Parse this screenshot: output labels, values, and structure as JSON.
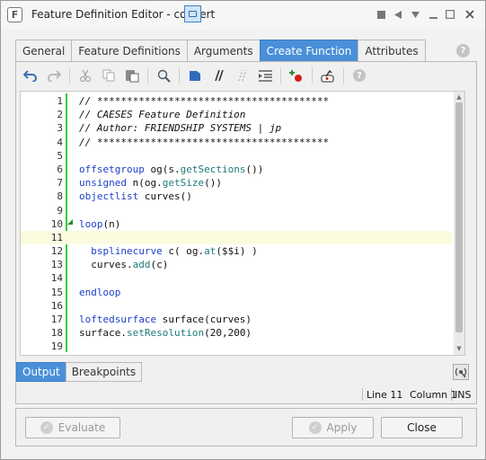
{
  "window": {
    "app_icon_letter": "F",
    "title": "Feature Definition Editor - convert"
  },
  "tabs": [
    {
      "label": "General"
    },
    {
      "label": "Feature Definitions"
    },
    {
      "label": "Arguments"
    },
    {
      "label": "Create Function",
      "active": true
    },
    {
      "label": "Attributes"
    }
  ],
  "toolbar": {
    "icons": [
      "undo-icon",
      "redo-icon",
      "cut-icon",
      "copy-icon",
      "paste-icon",
      "search-icon",
      "comment-block-icon",
      "comment-icon",
      "uncomment-icon",
      "indent-icon",
      "insert-breakpoint-icon",
      "run-to-cursor-icon",
      "help-icon"
    ]
  },
  "editor": {
    "current_line": 11,
    "lines": [
      {
        "n": "1",
        "text": "// ***************************************",
        "style": "com"
      },
      {
        "n": "2",
        "text": "// CAESES Feature Definition",
        "style": "com"
      },
      {
        "n": "3",
        "text": "// Author: FRIENDSHIP SYSTEMS | jp",
        "style": "com"
      },
      {
        "n": "4",
        "text": "// ***************************************",
        "style": "com"
      },
      {
        "n": "5",
        "text": "",
        "style": ""
      },
      {
        "n": "6",
        "kw": "offsetgroup",
        "rest": " og(s.",
        "fn": "getSections",
        "tail": "())"
      },
      {
        "n": "7",
        "kw": "unsigned",
        "rest": " n(og.",
        "fn": "getSize",
        "tail": "())"
      },
      {
        "n": "8",
        "kw": "objectlist",
        "rest": " curves()",
        "fn": "",
        "tail": ""
      },
      {
        "n": "9",
        "text": "",
        "style": ""
      },
      {
        "n": "10",
        "kw": "loop",
        "rest": "(n)",
        "fn": "",
        "tail": ""
      },
      {
        "n": "11",
        "text": "",
        "style": ""
      },
      {
        "n": "12",
        "kw": "  bsplinecurve",
        "rest": " c( og.",
        "fn": "at",
        "tail": "($$i) )"
      },
      {
        "n": "13",
        "kw": "",
        "rest": "  curves.",
        "fn": "add",
        "tail": "(c)"
      },
      {
        "n": "14",
        "text": "",
        "style": ""
      },
      {
        "n": "15",
        "kw": "endloop",
        "rest": "",
        "fn": "",
        "tail": ""
      },
      {
        "n": "16",
        "text": "",
        "style": ""
      },
      {
        "n": "17",
        "kw": "loftedsurface",
        "rest": " surface(curves)",
        "fn": "",
        "tail": ""
      },
      {
        "n": "18",
        "kw": "",
        "rest": "surface.",
        "fn": "setResolution",
        "tail": "(20,200)"
      },
      {
        "n": "19",
        "text": "",
        "style": ""
      }
    ]
  },
  "bottom_tabs": [
    {
      "label": "Output",
      "active": true
    },
    {
      "label": "Breakpoints"
    }
  ],
  "status": {
    "line": "Line 11",
    "column": "Column 1",
    "mode": "INS"
  },
  "buttons": {
    "evaluate": "Evaluate",
    "apply": "Apply",
    "close": "Close"
  },
  "colors": {
    "accent": "#4a90d9",
    "keyword": "#1e3fc8",
    "function": "#1f7a7a",
    "gutter_marker": "#33cc33"
  }
}
